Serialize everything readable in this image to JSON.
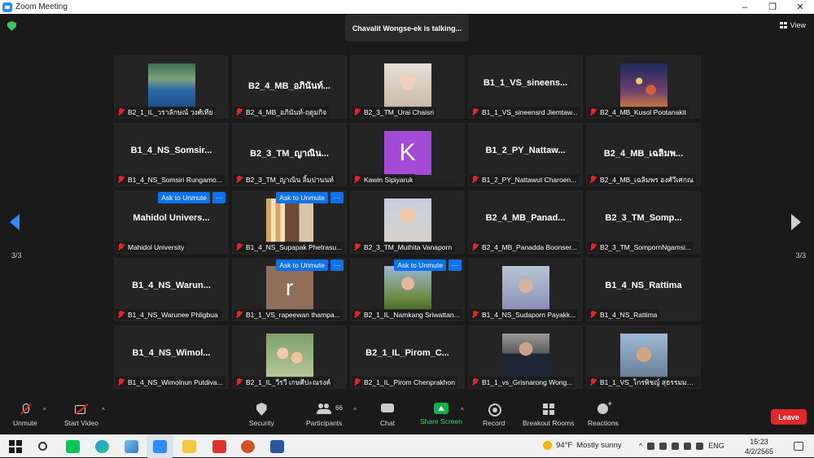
{
  "window": {
    "title": "Zoom Meeting",
    "controls": [
      "minimize-icon",
      "maximize-icon",
      "close-icon"
    ]
  },
  "meeting": {
    "talking_banner": "Chavalit Wongse-ek is talking...",
    "view_label": "View",
    "page_left": "3/3",
    "page_right": "3/3"
  },
  "tiles": [
    {
      "display": "",
      "label": "B2_1_IL_วราลักษณ์ วงศ์เทีย",
      "photo": "ph1",
      "unmute": false
    },
    {
      "display": "B2_4_MB_อภินันท์...",
      "label": "B2_4_MB_อภินันท์-ฤดูมกิจ",
      "photo": "",
      "unmute": false
    },
    {
      "display": "",
      "label": "B2_3_TM_Urai Chaisri",
      "photo": "ph3",
      "unmute": false
    },
    {
      "display": "B1_1_VS_sineens...",
      "label": "B1_1_VS_sineensrd Jiemtaw...",
      "photo": "",
      "unmute": false
    },
    {
      "display": "",
      "label": "B2_4_MB_Kusol Pootanakit",
      "photo": "ph4",
      "unmute": false
    },
    {
      "display": "B1_4_NS_Somsir...",
      "label": "B1_4_NS_Somsiri Rungamo...",
      "photo": "",
      "unmute": false
    },
    {
      "display": "B2_3_TM_ญาณิน...",
      "label": "B2_3_TM_ญาณิน ลิ้มปานนท์",
      "photo": "",
      "unmute": false
    },
    {
      "display": "",
      "label": "Kawin Sipiyaruk",
      "photo": "avatar-k",
      "avatar_letter": "K",
      "unmute": false
    },
    {
      "display": "B1_2_PY_Nattaw...",
      "label": "B1_2_PY_Nattawut Charoen...",
      "photo": "",
      "unmute": false
    },
    {
      "display": "B2_4_MB_เฉลิมพ...",
      "label": "B2_4_MB_เฉลิมพร องศ์วีเศกณ",
      "photo": "",
      "unmute": false
    },
    {
      "display": "Mahidol Univers...",
      "label": "Mahidol University",
      "photo": "",
      "unmute": true
    },
    {
      "display": "",
      "label": "B1_4_NS_Supapak Phetrasu...",
      "photo": "ph5",
      "unmute": true
    },
    {
      "display": "",
      "label": "B2_3_TM_Muthita Vanaporn",
      "photo": "ph6",
      "unmute": false
    },
    {
      "display": "B2_4_MB_Panad...",
      "label": "B2_4_MB_Panadda Boonser...",
      "photo": "",
      "unmute": false
    },
    {
      "display": "B2_3_TM_Somp...",
      "label": "B2_3_TM_SompornNgamsi...",
      "photo": "",
      "unmute": false
    },
    {
      "display": "B1_4_NS_Warun...",
      "label": "B1_4_NS_Warunee Phligbua",
      "photo": "",
      "unmute": false
    },
    {
      "display": "",
      "label": "B1_1_VS_rapeewan thampa...",
      "photo": "avatar-r",
      "avatar_letter": "r",
      "unmute": true
    },
    {
      "display": "",
      "label": "B2_1_IL_Namkang Sriwattan...",
      "photo": "ph7",
      "unmute": true
    },
    {
      "display": "",
      "label": "B1_4_NS_Sudaporn Payakk...",
      "photo": "ph8",
      "unmute": false
    },
    {
      "display": "B1_4_NS_Rattima",
      "label": "B1_4_NS_Rattima",
      "photo": "",
      "unmute": false
    },
    {
      "display": "B1_4_NS_Wimol...",
      "label": "B1_4_NS_Wimolnun Putdiva...",
      "photo": "",
      "unmute": false
    },
    {
      "display": "",
      "label": "B2_1_IL_วีรวี เกษศีปะณรงค์",
      "photo": "ph9",
      "unmute": false
    },
    {
      "display": "B2_1_IL_Pirom_C...",
      "label": "B2_1_IL_Pirom Chenprakhon",
      "photo": "",
      "unmute": false
    },
    {
      "display": "",
      "label": "B1_1_vs_Grisnarong Wong...",
      "photo": "ph10",
      "unmute": false
    },
    {
      "display": "",
      "label": "B1_1_VS_โกรพิชญ์ สุธรรมมาก...",
      "photo": "ph11",
      "unmute": false
    }
  ],
  "tile_buttons": {
    "ask_to_unmute": "Ask to Unmute",
    "more": "···"
  },
  "toolbar": {
    "unmute": "Unmute",
    "start_video": "Start Video",
    "security": "Security",
    "participants": "Participants",
    "participants_count": "66",
    "chat": "Chat",
    "share_screen": "Share Screen",
    "record": "Record",
    "breakout_rooms": "Breakout Rooms",
    "reactions": "Reactions",
    "leave": "Leave",
    "caret": "^"
  },
  "taskbar": {
    "weather_temp": "94°F",
    "weather_text": "Mostly sunny",
    "lang": "ENG",
    "time": "15:23",
    "date": "4/2/2565"
  },
  "colors": {
    "accent_blue": "#2d8cff",
    "ask_button": "#0e72ed",
    "share_green": "#12b24a",
    "leave_red": "#e02828",
    "muted_red": "#e02828"
  }
}
